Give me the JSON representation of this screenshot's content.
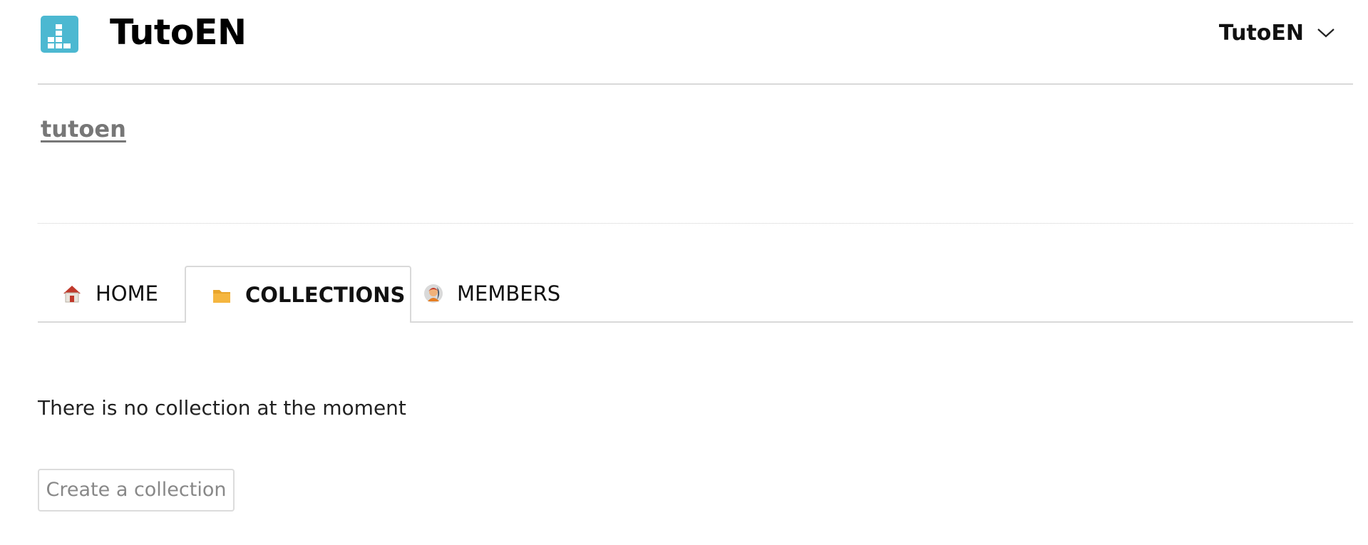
{
  "header": {
    "brand_title": "TutoEN",
    "account_name": "TutoEN"
  },
  "org": {
    "link_label": "tutoen"
  },
  "tabs": [
    {
      "label": "HOME",
      "icon": "home-icon",
      "active": false
    },
    {
      "label": "COLLECTIONS",
      "icon": "folder-icon",
      "active": true
    },
    {
      "label": "MEMBERS",
      "icon": "member-avatar-icon",
      "active": false
    }
  ],
  "collections": {
    "empty_message": "There is no collection at the moment",
    "create_label": "Create a collection"
  },
  "colors": {
    "logo": "#4cb8d1",
    "folder": "#f5b640",
    "home_roof": "#c0392b",
    "muted_text": "#777777",
    "border": "#d9d9d9"
  }
}
